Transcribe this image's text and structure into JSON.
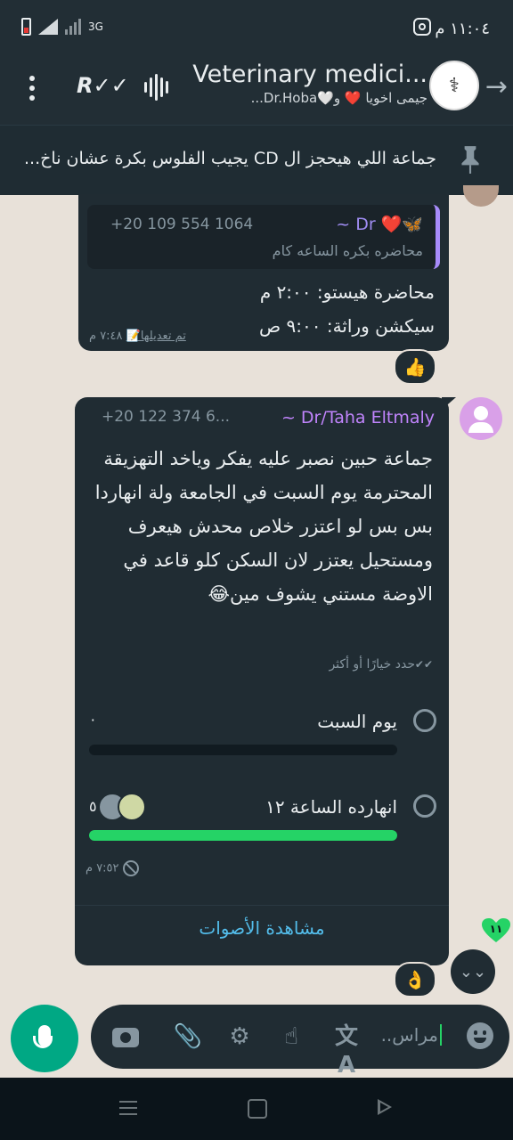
{
  "status_bar": {
    "time": "١١:٠٤ م",
    "network": "3G"
  },
  "header": {
    "title": "Veterinary medici...",
    "subtitle": "جيمى اخويا ❤️ و🤍Dr.Hoba..."
  },
  "pinned": {
    "text": "جماعة اللي هيحجز ال CD يجيب الفلوس بكرة عشان ناخ..."
  },
  "message1": {
    "quote_name": "~ Dr ❤️🦋",
    "quote_phone": "+20 109 554 1064",
    "quote_text": "محاضره بكره الساعه كام",
    "line1": "محاضرة هيستو: ٢:٠٠ م",
    "line2": "سيكشن وراثة: ٩:٠٠ ص",
    "edited": "تم تعديلها📝",
    "time": "٧:٤٨ م",
    "reaction": "👍"
  },
  "message2": {
    "sender": "~ Dr/Taha Eltmaly",
    "phone": "+20 122 374 6...",
    "body": "جماعة حبين نصبر عليه يفكر وياخد التهزيقة المحترمة يوم السبت في الجامعة ولة انهاردا بس بس لو اعتزر خلاص محدش هيعرف ومستحيل يعتزر لان السكن كلو قاعد في الاوضة مستني يشوف مين😂",
    "hint": "حدد خيارًا أو أكثر",
    "options": [
      {
        "label": "يوم السبت",
        "count": "٠",
        "fraction": 0.0
      },
      {
        "label": "انهارده الساعة ١٢",
        "count": "٥",
        "fraction": 1.0
      }
    ],
    "time": "٧:٥٢ م",
    "view_votes": "مشاهدة الأصوات",
    "reaction": "👌"
  },
  "unread_badge": "١١",
  "input": {
    "placeholder": "مراس.."
  },
  "colors": {
    "accent": "#00a884",
    "poll_fill": "#25d366",
    "link": "#53bdeb"
  }
}
